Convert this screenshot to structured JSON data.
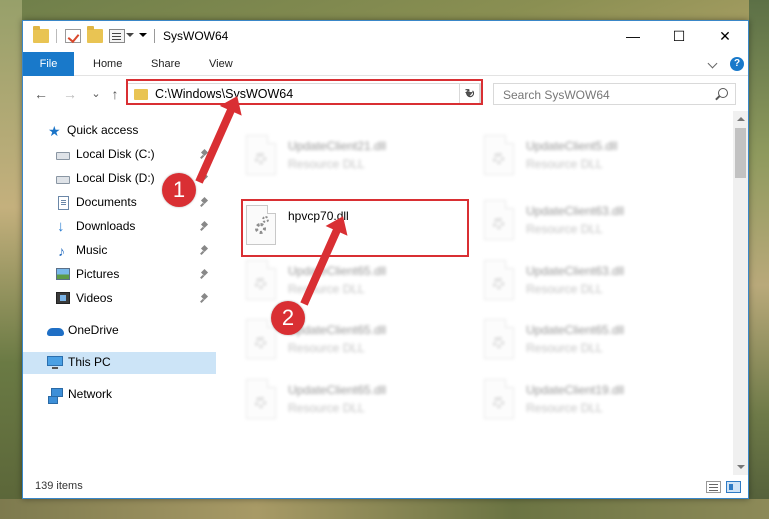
{
  "window": {
    "title": "SysWOW64",
    "minimize_glyph": "—",
    "maximize_glyph": "☐",
    "close_glyph": "✕"
  },
  "ribbon": {
    "tabs": [
      {
        "label": "File"
      },
      {
        "label": "Home"
      },
      {
        "label": "Share"
      },
      {
        "label": "View"
      }
    ],
    "help_glyph": "?"
  },
  "navigation": {
    "back_glyph": "←",
    "forward_glyph": "→",
    "recent_glyph": "⌄",
    "up_glyph": "↑",
    "address": "C:\\Windows\\SysWOW64",
    "refresh_glyph": "↻",
    "search_placeholder": "Search SysWOW64"
  },
  "sidebar": {
    "items": [
      {
        "label": "Quick access",
        "icon": "star-icon"
      },
      {
        "label": "Local Disk (C:)",
        "icon": "drive-icon",
        "pinned": true
      },
      {
        "label": "Local Disk (D:)",
        "icon": "drive-icon",
        "pinned": true
      },
      {
        "label": "Documents",
        "icon": "documents-icon",
        "pinned": true
      },
      {
        "label": "Downloads",
        "icon": "download-icon",
        "pinned": true
      },
      {
        "label": "Music",
        "icon": "music-icon",
        "pinned": true
      },
      {
        "label": "Pictures",
        "icon": "pictures-icon",
        "pinned": true
      },
      {
        "label": "Videos",
        "icon": "videos-icon",
        "pinned": true
      },
      {
        "label": "OneDrive",
        "icon": "cloud-icon"
      },
      {
        "label": "This PC",
        "icon": "computer-icon",
        "selected": true
      },
      {
        "label": "Network",
        "icon": "network-icon"
      }
    ]
  },
  "files": {
    "highlighted": {
      "name": "hpvcp70.dll",
      "type": ""
    },
    "background": [
      {
        "name": "UpdateClient21.dll",
        "type": "Resource DLL"
      },
      {
        "name": "UpdateClient5.dll",
        "type": "Resource DLL"
      },
      {
        "name": "UpdateClient63.dll",
        "type": "Resource DLL"
      },
      {
        "name": "UpdateClient65.dll",
        "type": "Resource DLL"
      },
      {
        "name": "UpdateClient63.dll",
        "type": "Resource DLL"
      },
      {
        "name": "UpdateClient65.dll",
        "type": "Resource DLL"
      },
      {
        "name": "UpdateClient65.dll",
        "type": "Resource DLL"
      },
      {
        "name": "UpdateClient65.dll",
        "type": "Resource DLL"
      },
      {
        "name": "UpdateClient19.dll",
        "type": "Resource DLL"
      }
    ]
  },
  "status": {
    "item_count": "139 items"
  },
  "callouts": [
    {
      "number": "1"
    },
    {
      "number": "2"
    }
  ],
  "colors": {
    "accent": "#1979ca",
    "callout": "#d92f33",
    "selection": "#cce4f7"
  }
}
